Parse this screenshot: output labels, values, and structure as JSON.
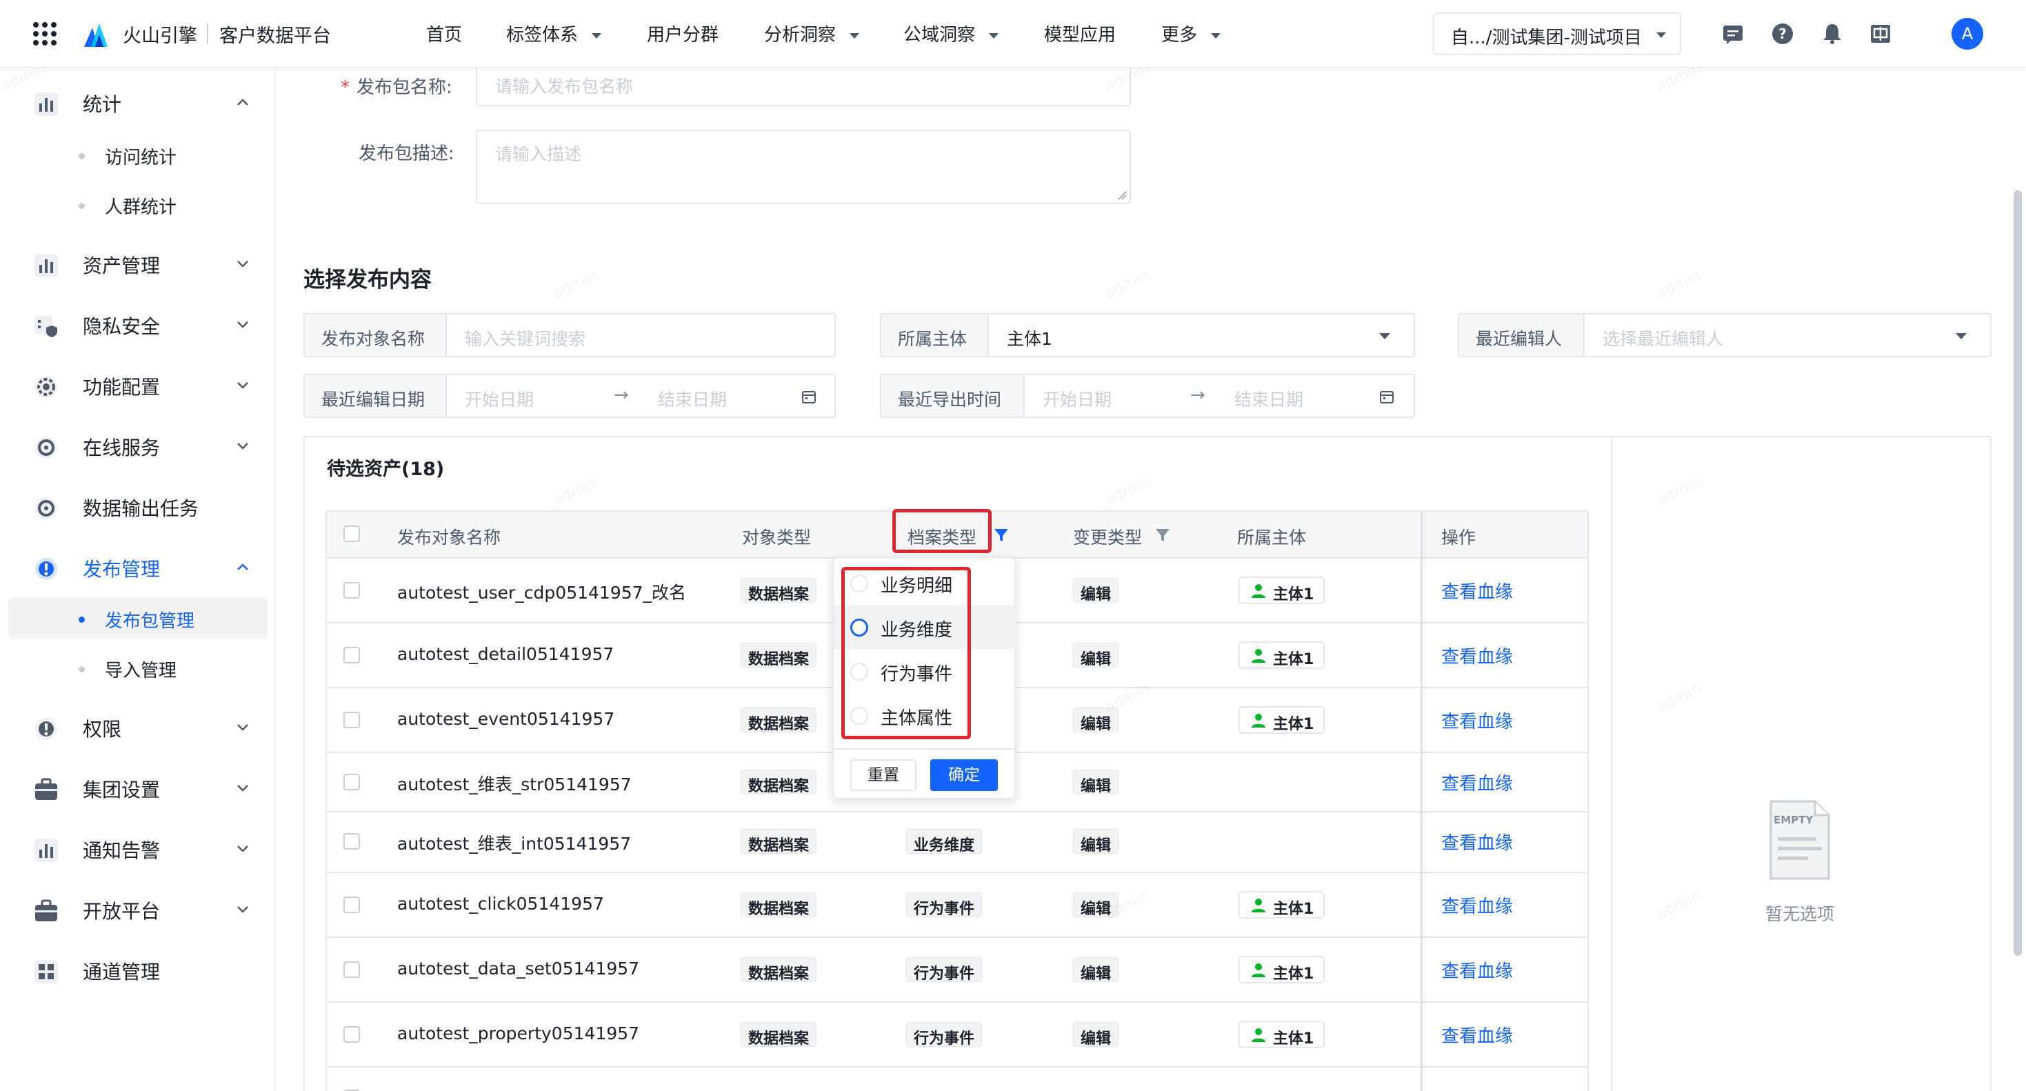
{
  "topbar": {
    "brand": "火山引擎",
    "product": "客户数据平台",
    "nav": [
      {
        "label": "首页",
        "dropdown": false
      },
      {
        "label": "标签体系",
        "dropdown": true
      },
      {
        "label": "用户分群",
        "dropdown": false
      },
      {
        "label": "分析洞察",
        "dropdown": true
      },
      {
        "label": "公域洞察",
        "dropdown": true
      },
      {
        "label": "模型应用",
        "dropdown": false
      },
      {
        "label": "更多",
        "dropdown": true
      }
    ],
    "project": "自.../测试集团-测试项目",
    "avatar": "A",
    "icons": [
      "message-icon",
      "help-icon",
      "bell-icon",
      "language-icon"
    ]
  },
  "sidebar": {
    "items": [
      {
        "label": "统计",
        "icon": "bar-chart-icon",
        "expanded": true
      },
      {
        "label": "访问统计",
        "sub": true
      },
      {
        "label": "人群统计",
        "sub": true
      },
      {
        "label": "资产管理",
        "icon": "bar-chart-icon",
        "expanded": false
      },
      {
        "label": "隐私安全",
        "icon": "shield-icon",
        "expanded": false
      },
      {
        "label": "功能配置",
        "icon": "gear-icon",
        "expanded": false
      },
      {
        "label": "在线服务",
        "icon": "cloud-icon",
        "expanded": false
      },
      {
        "label": "数据输出任务",
        "icon": "refresh-icon"
      },
      {
        "label": "发布管理",
        "icon": "publish-icon",
        "expanded": true,
        "active": true
      },
      {
        "label": "发布包管理",
        "sub": true,
        "active": true
      },
      {
        "label": "导入管理",
        "sub": true
      },
      {
        "label": "权限",
        "icon": "lock-icon",
        "expanded": false
      },
      {
        "label": "集团设置",
        "icon": "briefcase-icon",
        "expanded": false
      },
      {
        "label": "通知告警",
        "icon": "bar-chart-icon",
        "expanded": false
      },
      {
        "label": "开放平台",
        "icon": "briefcase-icon",
        "expanded": false
      },
      {
        "label": "通道管理",
        "icon": "grid-icon"
      }
    ]
  },
  "form": {
    "name_label": "发布包名称:",
    "name_required": "*",
    "name_placeholder": "请输入发布包名称",
    "desc_label": "发布包描述:",
    "desc_placeholder": "请输入描述"
  },
  "section_title": "选择发布内容",
  "filters": {
    "object_name": {
      "label": "发布对象名称",
      "placeholder": "输入关键词搜索"
    },
    "subject": {
      "label": "所属主体",
      "value": "主体1"
    },
    "editor": {
      "label": "最近编辑人",
      "placeholder": "选择最近编辑人"
    },
    "edit_date": {
      "label": "最近编辑日期",
      "start": "开始日期",
      "end": "结束日期",
      "arrow": "→"
    },
    "export_time": {
      "label": "最近导出时间",
      "start": "开始日期",
      "end": "结束日期",
      "arrow": "→"
    }
  },
  "table": {
    "title": "待选资产(18)",
    "columns": [
      "发布对象名称",
      "对象类型",
      "档案类型",
      "变更类型",
      "所属主体",
      "操作"
    ],
    "rows": [
      {
        "name": "autotest_user_cdp05141957_改名",
        "obj_type": "数据档案",
        "archive_type": "",
        "change": "编辑",
        "subject": "主体1",
        "action": "查看血缘"
      },
      {
        "name": "autotest_detail05141957",
        "obj_type": "数据档案",
        "archive_type": "",
        "change": "编辑",
        "subject": "主体1",
        "action": "查看血缘"
      },
      {
        "name": "autotest_event05141957",
        "obj_type": "数据档案",
        "archive_type": "",
        "change": "编辑",
        "subject": "主体1",
        "action": "查看血缘"
      },
      {
        "name": "autotest_维表_str05141957",
        "obj_type": "数据档案",
        "archive_type": "",
        "change": "编辑",
        "subject": "",
        "action": "查看血缘"
      },
      {
        "name": "autotest_维表_int05141957",
        "obj_type": "数据档案",
        "archive_type": "业务维度",
        "change": "编辑",
        "subject": "",
        "action": "查看血缘"
      },
      {
        "name": "autotest_click05141957",
        "obj_type": "数据档案",
        "archive_type": "行为事件",
        "change": "编辑",
        "subject": "主体1",
        "action": "查看血缘"
      },
      {
        "name": "autotest_data_set05141957",
        "obj_type": "数据档案",
        "archive_type": "行为事件",
        "change": "编辑",
        "subject": "主体1",
        "action": "查看血缘"
      },
      {
        "name": "autotest_property05141957",
        "obj_type": "数据档案",
        "archive_type": "行为事件",
        "change": "编辑",
        "subject": "主体1",
        "action": "查看血缘"
      }
    ]
  },
  "archive_filter": {
    "options": [
      "业务明细",
      "业务维度",
      "行为事件",
      "主体属性"
    ],
    "hovered": "业务维度",
    "reset": "重置",
    "confirm": "确定"
  },
  "selected_panel": {
    "empty_text": "暂无选项",
    "empty_badge": "EMPTY"
  },
  "watermark": "admin",
  "colors": {
    "primary": "#1664ff",
    "highlight": "#e0262f",
    "success": "#00b42a"
  }
}
